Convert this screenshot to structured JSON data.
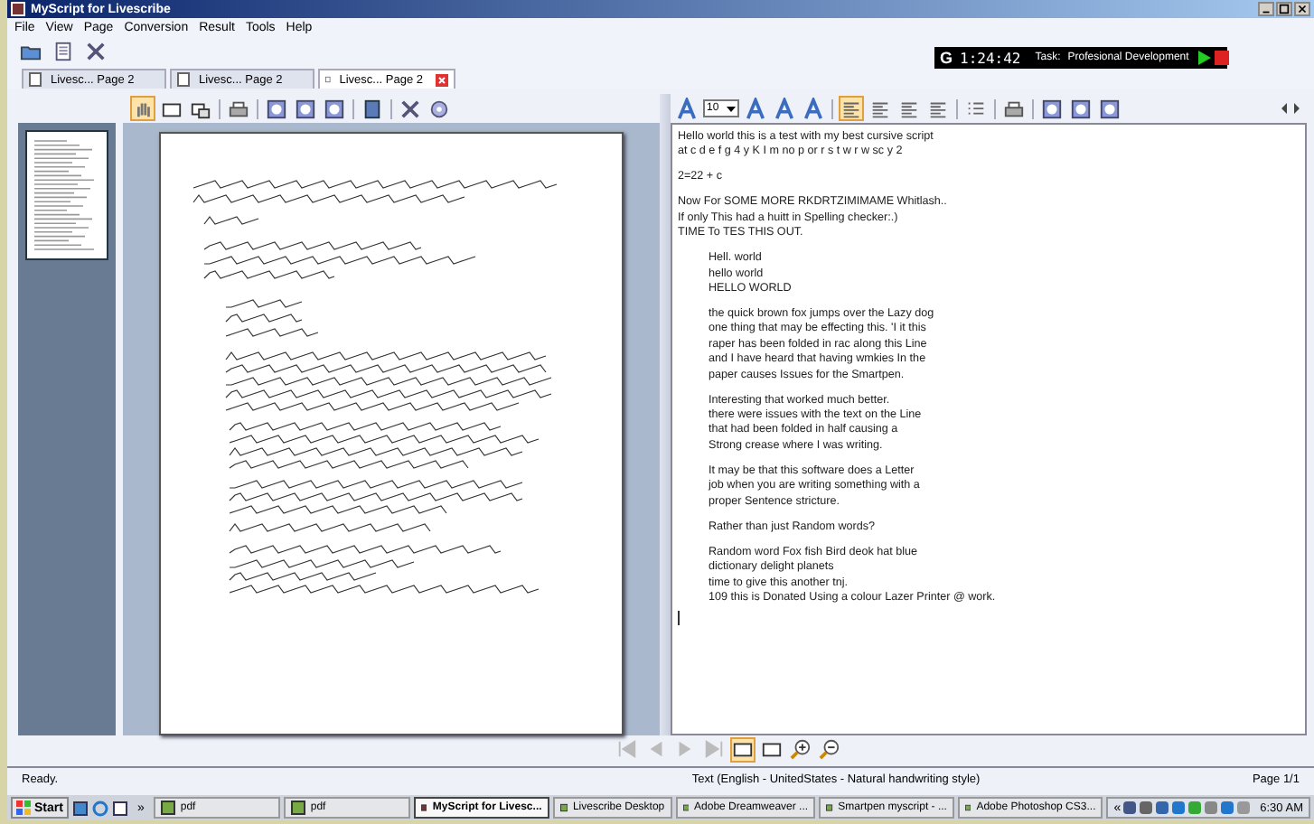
{
  "window": {
    "title": "MyScript for Livescribe"
  },
  "menu": [
    "File",
    "View",
    "Page",
    "Conversion",
    "Result",
    "Tools",
    "Help"
  ],
  "timer": {
    "logo": "G",
    "time": "1:24:42",
    "task_label": "Task:",
    "task": "Profesional Development",
    "running": true
  },
  "tabs": [
    {
      "label": "Livesc... Page 2",
      "selected": false
    },
    {
      "label": "Livesc... Page 2",
      "selected": false
    },
    {
      "label": "Livesc... Page 2",
      "selected": true
    }
  ],
  "view_tools": [
    {
      "selected": true
    },
    {
      "selected": false
    },
    {
      "selected": false
    }
  ],
  "font_size": "10",
  "align_tools": [
    {
      "selected": true
    },
    {
      "selected": false
    },
    {
      "selected": false
    },
    {
      "selected": false
    }
  ],
  "page_tools": [
    {
      "selected": true
    },
    {
      "selected": false
    }
  ],
  "result_text": [
    {
      "indented": false,
      "lines": [
        "Hello world this is a test with my best cursive script",
        "at c d e f g 4 y K I m no p or r s t w r w sc y 2"
      ]
    },
    {
      "indented": false,
      "lines": [
        "2=22 + c"
      ]
    },
    {
      "indented": false,
      "lines": [
        "Now For SOME MORE RKDRTZIMIMAME Whitlash..",
        "If only This had a huitt in Spelling checker:.)",
        "TIME To TES THIS OUT."
      ]
    },
    {
      "indented": true,
      "lines": [
        "Hell. world",
        "hello world",
        "HELLO WORLD"
      ]
    },
    {
      "indented": true,
      "lines": [
        "the quick brown fox jumps over the Lazy dog",
        "one thing that may be effecting this. 'I it this",
        "raper has been folded in rac along this Line",
        "and I have heard that having wmkies In the",
        "paper causes Issues for the Smartpen."
      ]
    },
    {
      "indented": true,
      "lines": [
        "Interesting that worked much better.",
        "there were issues with the text on the Line",
        "that had been folded in half causing a",
        "Strong crease where I was writing."
      ]
    },
    {
      "indented": true,
      "lines": [
        "It may be that this software does a Letter",
        "job when you are writing something with a",
        "proper Sentence stricture."
      ]
    },
    {
      "indented": true,
      "lines": [
        "Rather than just Random words?"
      ]
    },
    {
      "indented": true,
      "lines": [
        "Random word Fox fish Bird deok hat blue",
        "dictionary delight planets",
        "time to give this another tnj.",
        "109 this is Donated Using a colour Lazer Printer @ work."
      ]
    }
  ],
  "status_bar": {
    "state": "Ready.",
    "recognition": "Text (English - UnitedStates - Natural handwriting style)",
    "page": "Page 1/1"
  },
  "taskbar": {
    "start": "Start",
    "more": "»",
    "buttons": [
      {
        "label": "pdf",
        "selected": false
      },
      {
        "label": "pdf",
        "selected": false
      },
      {
        "label": "MyScript for Livesc...",
        "selected": true
      },
      {
        "label": "Livescribe Desktop",
        "selected": false
      },
      {
        "label": "Adobe Dreamweaver ...",
        "selected": false
      },
      {
        "label": "Smartpen myscript - ...",
        "selected": false
      },
      {
        "label": "Adobe Photoshop CS3...",
        "selected": false
      }
    ],
    "tray_toggle": "«",
    "clock": "6:30 AM"
  }
}
